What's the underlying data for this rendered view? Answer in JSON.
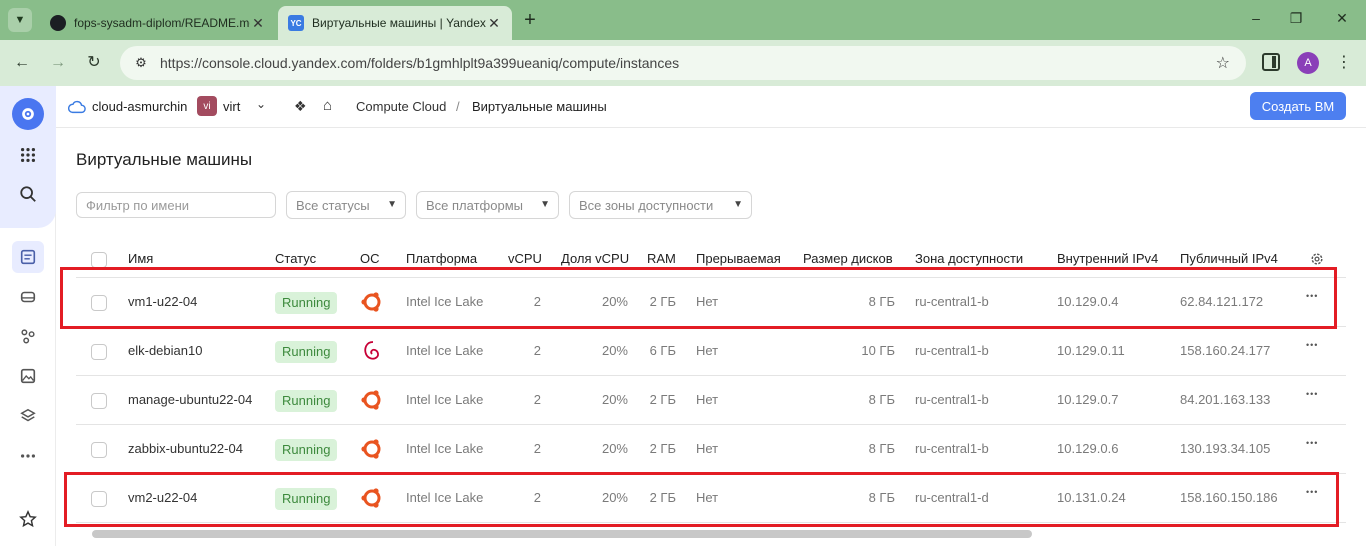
{
  "browser": {
    "tabs": [
      {
        "title": "fops-sysadm-diplom/README.md",
        "icon": "github-icon"
      },
      {
        "title": "Виртуальные машины | Yandex Cloud",
        "icon": "yandex-cloud-icon",
        "favicon_text": "YC"
      }
    ],
    "url": "https://console.cloud.yandex.com/folders/b1gmhlplt9a399ueaniq/compute/instances",
    "profile_initial": "A"
  },
  "header": {
    "cloud_name": "cloud-asmurchin",
    "folder_badge": "vi",
    "folder_name": "virt",
    "breadcrumb_service": "Compute Cloud",
    "breadcrumb_separator": "/",
    "breadcrumb_page": "Виртуальные машины",
    "create_button": "Создать ВМ"
  },
  "page": {
    "title": "Виртуальные машины"
  },
  "filters": {
    "name_placeholder": "Фильтр по имени",
    "status": "Все статусы",
    "platform": "Все платформы",
    "zone": "Все зоны доступности"
  },
  "table": {
    "columns": [
      "Имя",
      "Статус",
      "ОС",
      "Платформа",
      "vCPU",
      "Доля vCPU",
      "RAM",
      "Прерываемая",
      "Размер дисков",
      "Зона доступности",
      "Внутренний IPv4",
      "Публичный IPv4"
    ],
    "rows": [
      {
        "name": "vm1-u22-04",
        "status": "Running",
        "os": "ubuntu",
        "platform": "Intel Ice Lake",
        "vcpu": "2",
        "vcpu_share": "20%",
        "ram": "2 ГБ",
        "preemptible": "Нет",
        "disk": "8 ГБ",
        "zone": "ru-central1-b",
        "internal_ip": "10.129.0.4",
        "public_ip": "62.84.121.172"
      },
      {
        "name": "elk-debian10",
        "status": "Running",
        "os": "debian",
        "platform": "Intel Ice Lake",
        "vcpu": "2",
        "vcpu_share": "20%",
        "ram": "6 ГБ",
        "preemptible": "Нет",
        "disk": "10 ГБ",
        "zone": "ru-central1-b",
        "internal_ip": "10.129.0.11",
        "public_ip": "158.160.24.177"
      },
      {
        "name": "manage-ubuntu22-04",
        "status": "Running",
        "os": "ubuntu",
        "platform": "Intel Ice Lake",
        "vcpu": "2",
        "vcpu_share": "20%",
        "ram": "2 ГБ",
        "preemptible": "Нет",
        "disk": "8 ГБ",
        "zone": "ru-central1-b",
        "internal_ip": "10.129.0.7",
        "public_ip": "84.201.163.133"
      },
      {
        "name": "zabbix-ubuntu22-04",
        "status": "Running",
        "os": "ubuntu",
        "platform": "Intel Ice Lake",
        "vcpu": "2",
        "vcpu_share": "20%",
        "ram": "2 ГБ",
        "preemptible": "Нет",
        "disk": "8 ГБ",
        "zone": "ru-central1-b",
        "internal_ip": "10.129.0.6",
        "public_ip": "130.193.34.105"
      },
      {
        "name": "vm2-u22-04",
        "status": "Running",
        "os": "ubuntu",
        "platform": "Intel Ice Lake",
        "vcpu": "2",
        "vcpu_share": "20%",
        "ram": "2 ГБ",
        "preemptible": "Нет",
        "disk": "8 ГБ",
        "zone": "ru-central1-d",
        "internal_ip": "10.131.0.24",
        "public_ip": "158.160.150.186"
      }
    ],
    "highlighted_rows": [
      "vm1-u22-04",
      "vm2-u22-04"
    ]
  },
  "colors": {
    "accent": "#4d7ff0",
    "status_bg": "#d9f2d9",
    "status_text": "#3d8a3d",
    "highlight": "#e31c24",
    "ubuntu": "#e95420",
    "debian": "#c70036"
  }
}
